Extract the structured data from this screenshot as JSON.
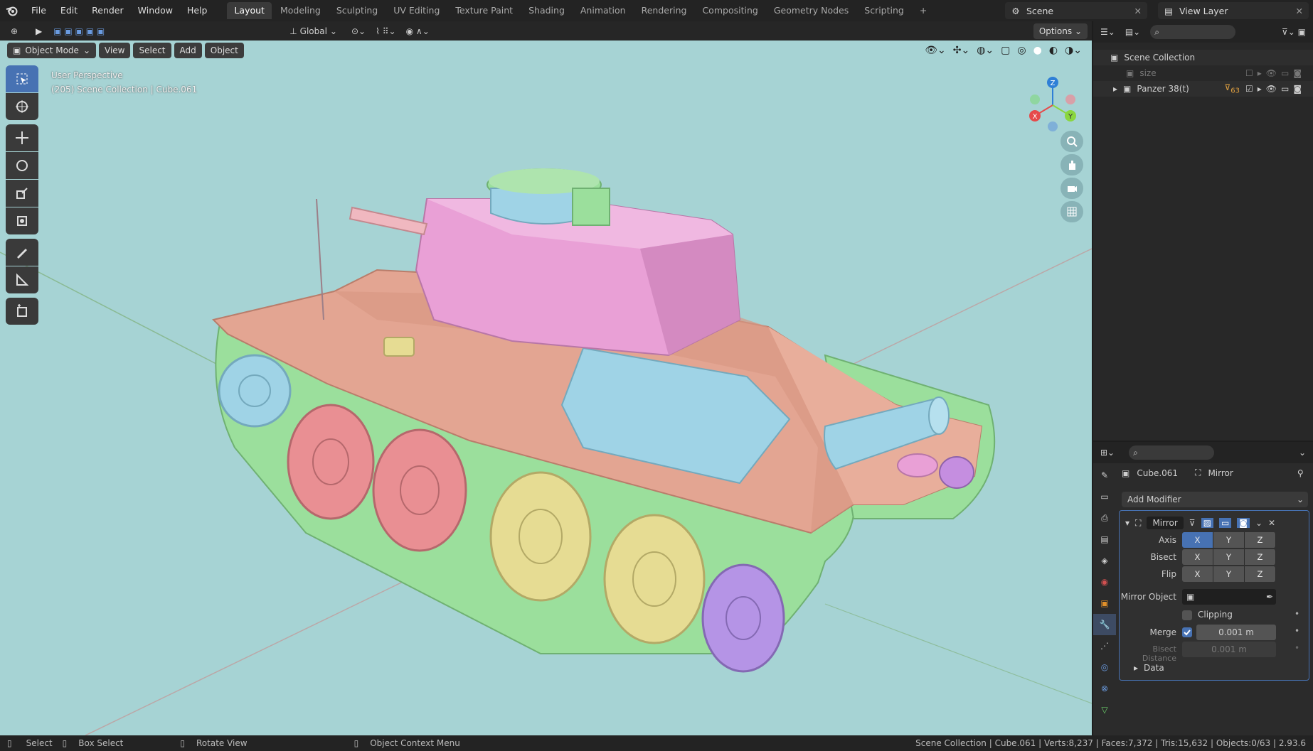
{
  "menu": [
    "File",
    "Edit",
    "Render",
    "Window",
    "Help"
  ],
  "workspaces": [
    "Layout",
    "Modeling",
    "Sculpting",
    "UV Editing",
    "Texture Paint",
    "Shading",
    "Animation",
    "Rendering",
    "Compositing",
    "Geometry Nodes",
    "Scripting"
  ],
  "scene_name": "Scene",
  "view_layer": "View Layer",
  "viewport": {
    "orientation": "Global",
    "options_label": "Options",
    "mode": "Object Mode",
    "menus": [
      "View",
      "Select",
      "Add",
      "Object"
    ],
    "info_line1": "User Perspective",
    "info_line2": "(205) Scene Collection | Cube.061",
    "gizmo": {
      "x": "X",
      "y": "Y",
      "z": "Z"
    }
  },
  "outliner": {
    "root": "Scene Collection",
    "items": [
      {
        "label": "size"
      },
      {
        "label": "Panzer 38(t)"
      }
    ],
    "filter_badge": "63"
  },
  "properties": {
    "object_name": "Cube.061",
    "modifier_crumb": "Mirror",
    "add_modifier": "Add Modifier",
    "modifier_name": "Mirror",
    "axis_label": "Axis",
    "bisect_label": "Bisect",
    "flip_label": "Flip",
    "axes": [
      "X",
      "Y",
      "Z"
    ],
    "axis_state": [
      true,
      false,
      false
    ],
    "mirror_object_label": "Mirror Object",
    "clipping_label": "Clipping",
    "merge_label": "Merge",
    "merge_value": "0.001 m",
    "bisect_distance_label": "Bisect Distance",
    "bisect_distance_value": "0.001 m",
    "data_label": "Data"
  },
  "status": {
    "select": "Select",
    "box_select": "Box Select",
    "rotate": "Rotate View",
    "context": "Object Context Menu",
    "stats": "Scene Collection | Cube.061 | Verts:8,237 | Faces:7,372 | Tris:15,632 | Objects:0/63 | 2.93.6"
  },
  "colors": {
    "accent": "#4772b3",
    "viewport_bg": "#a6d3d4",
    "tank_body": "#e3a592",
    "turret": "#e9a0d6",
    "track": "#9bdf9c",
    "wheel_red": "#e98f93",
    "wheel_yellow": "#e6dc93",
    "wheel_purple": "#b594e6",
    "blue_part": "#9fd3e6"
  }
}
